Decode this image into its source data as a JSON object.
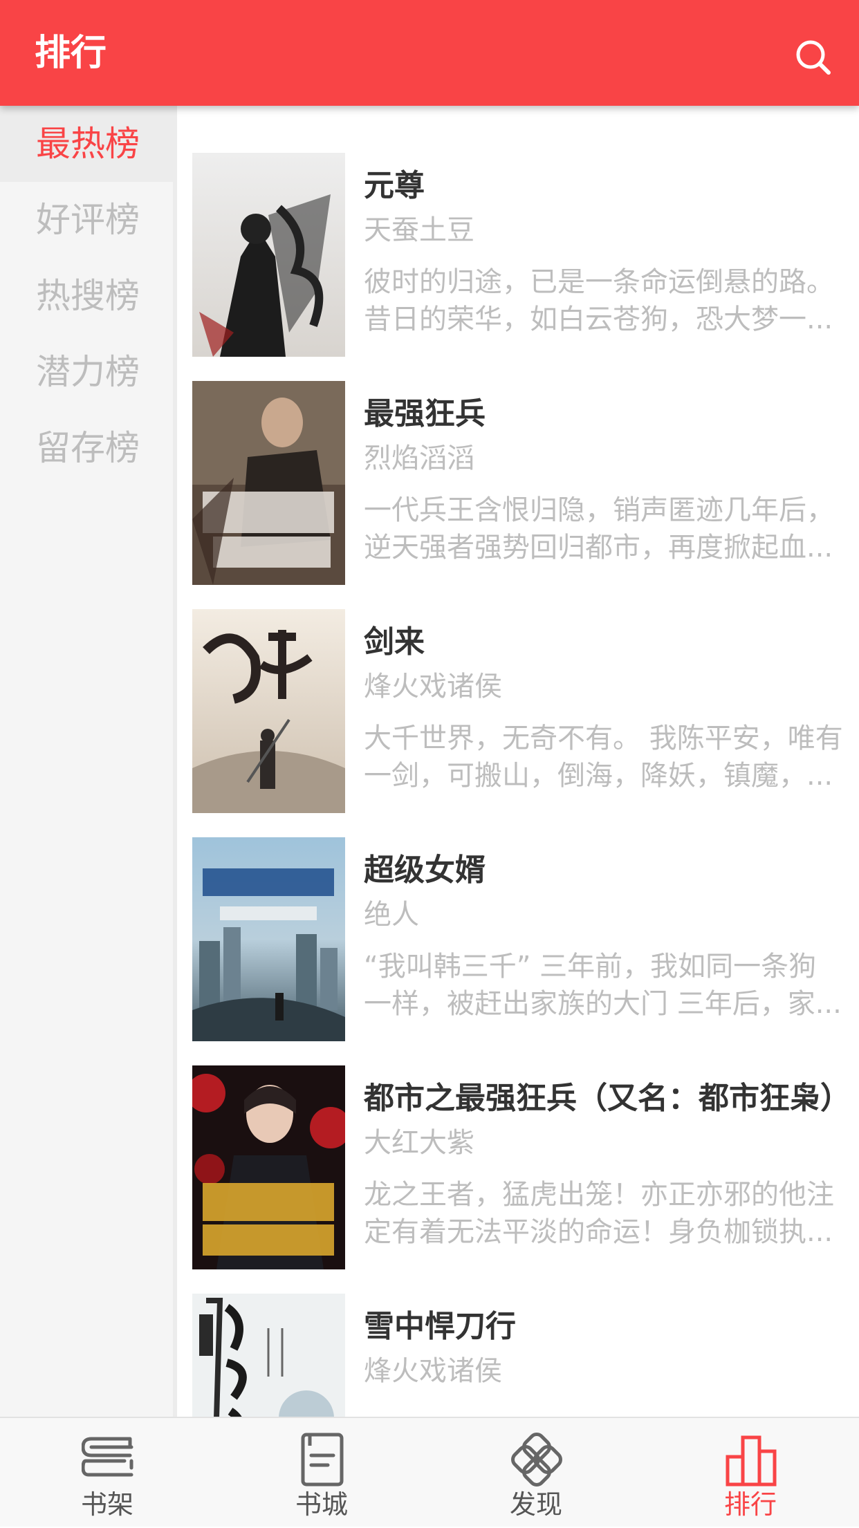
{
  "header": {
    "title": "排行",
    "search_icon": "search-icon"
  },
  "colors": {
    "accent": "#f94446",
    "muted_text": "#bdbdbd",
    "title_text": "#333333"
  },
  "sidebar": {
    "items": [
      {
        "label": "最热榜",
        "active": true
      },
      {
        "label": "好评榜",
        "active": false
      },
      {
        "label": "热搜榜",
        "active": false
      },
      {
        "label": "潜力榜",
        "active": false
      },
      {
        "label": "留存榜",
        "active": false
      }
    ]
  },
  "books": [
    {
      "title": "元尊",
      "author": "天蚕土豆",
      "desc1": "彼时的归途，已是一条命运倒悬的路。",
      "desc2": "昔日的荣华，如白云苍狗，恐大梦一..."
    },
    {
      "title": "最强狂兵",
      "author": "烈焰滔滔",
      "desc1": "一代兵王含恨归隐，销声匿迹几年后，",
      "desc2": "逆天强者强势回归都市，再度掀起血..."
    },
    {
      "title": "剑来",
      "author": "烽火戏诸侯",
      "desc1": "大千世界，无奇不有。 我陈平安，唯有",
      "desc2": "一剑，可搬山，倒海，降妖，镇魔，..."
    },
    {
      "title": "超级女婿",
      "author": "绝人",
      "desc1": "“我叫韩三千” 三年前，我如同一条狗",
      "desc2": "一样，被赶出家族的大门 三年后，家..."
    },
    {
      "title": "都市之最强狂兵（又名：都市狂枭）",
      "author": "大红大紫",
      "desc1": "龙之王者，猛虎出笼！亦正亦邪的他注",
      "desc2": "定有着无法平淡的命运！身负枷锁执..."
    },
    {
      "title": "雪中悍刀行",
      "author": "烽火戏诸侯",
      "desc1": "",
      "desc2": ""
    }
  ],
  "tabbar": {
    "tabs": [
      {
        "label": "书架",
        "icon": "bookshelf-icon",
        "active": false
      },
      {
        "label": "书城",
        "icon": "bookstore-icon",
        "active": false
      },
      {
        "label": "发现",
        "icon": "discover-icon",
        "active": false
      },
      {
        "label": "排行",
        "icon": "ranking-icon",
        "active": true
      }
    ]
  }
}
